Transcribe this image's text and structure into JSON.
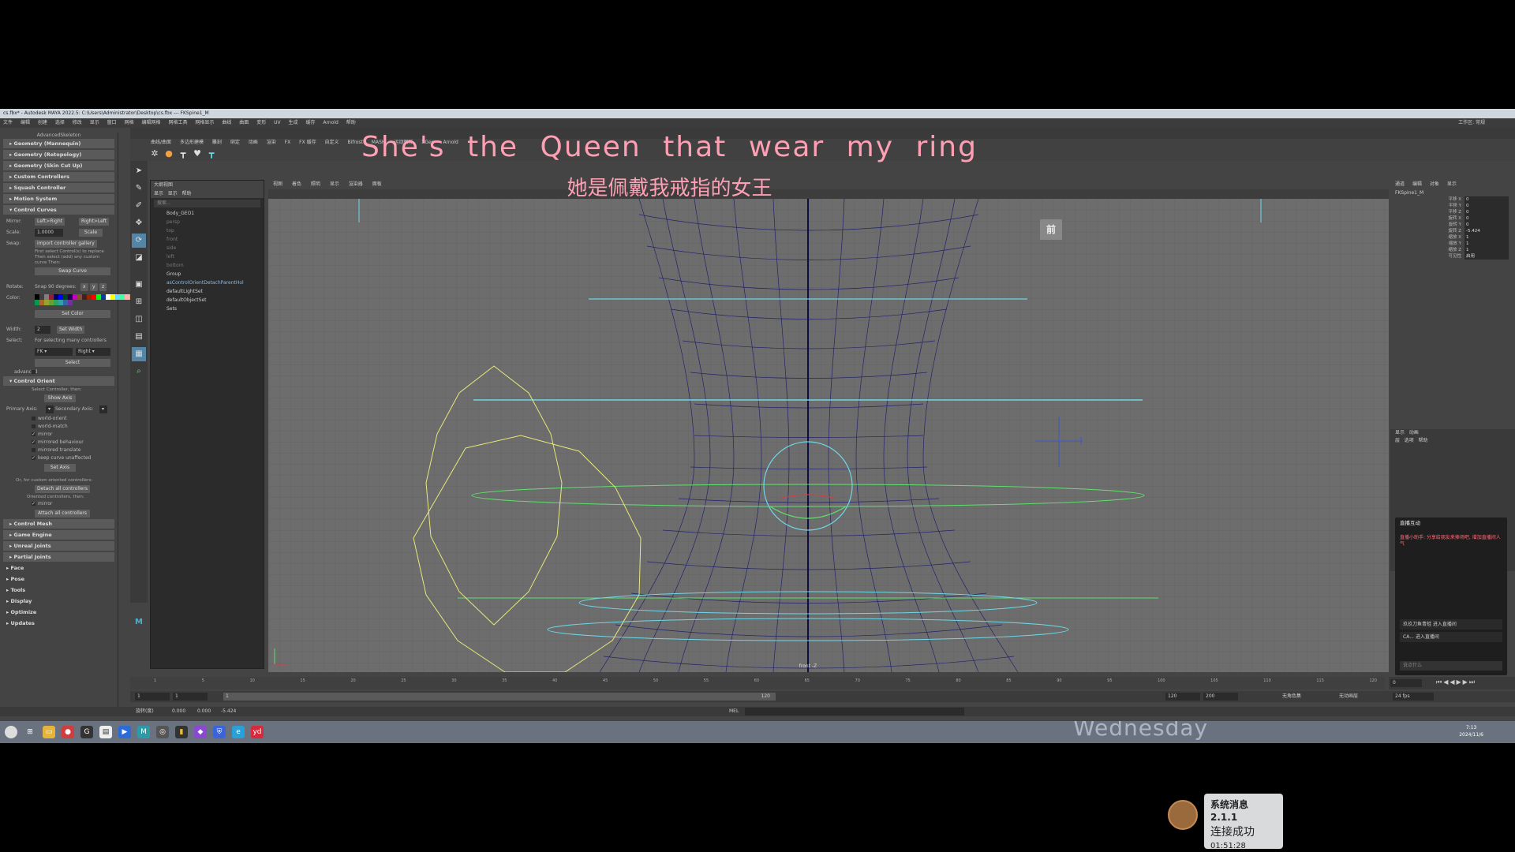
{
  "window": {
    "title": "cs.fbx* - Autodesk MAYA 2022.5: C:\\Users\\Administrator\\Desktop\\cs.fbx  ---  FKSpine1_M",
    "workspace": "工作区: 常规"
  },
  "menus": [
    "文件",
    "编辑",
    "创建",
    "选择",
    "修改",
    "显示",
    "窗口",
    "网格",
    "编辑网格",
    "网格工具",
    "网格显示",
    "曲线",
    "曲面",
    "变形",
    "UV",
    "生成",
    "缓存",
    "Arnold",
    "帮助"
  ],
  "shelf_tabs": [
    "曲线/曲面",
    "多边形建模",
    "雕刻",
    "绑定",
    "动画",
    "渲染",
    "FX",
    "FX 缓存",
    "自定义",
    "Bifrost",
    "MASH",
    "运动图形",
    "XGen",
    "Arnold"
  ],
  "left_panel": {
    "header": "AdvancedSkeleton",
    "sections_top": [
      "Geometry (Mannequin)",
      "Geometry (Retopology)",
      "Geometry (Skin Cut Up)",
      "Custom Controllers",
      "Squash Controller",
      "Motion System"
    ],
    "control_curves": "Control Curves",
    "mirror_label": "Mirror:",
    "mirror_a": "Left>Right",
    "mirror_b": "Right>Left",
    "scale_label": "Scale:",
    "scale_value": "1.0000",
    "scale_btn": "Scale",
    "swap_label": "Swap:",
    "swap_gallery": "import controller gallery",
    "swap_note": "First select Control(s) to replace Then select (add) any custom curve Then:",
    "swap_btn": "Swap Curve",
    "rotate_label": "Rotate:",
    "rotate_value": "Snap 90 degrees:",
    "rx": "x",
    "ry": "y",
    "rz": "z",
    "color_label": "Color:",
    "set_color": "Set Color",
    "colors": [
      "#000000",
      "#3f3f3f",
      "#7f7f7f",
      "#9b1b30",
      "#000060",
      "#0000ff",
      "#004619",
      "#25004f",
      "#c700c7",
      "#894c33",
      "#3e231f",
      "#992600",
      "#ff0000",
      "#00ff00",
      "#004199",
      "#ffffff",
      "#ffff00",
      "#63dcff",
      "#43ffa3",
      "#ffb0b0",
      "#e4ac79",
      "#ffff63",
      "#009954",
      "#a5692f",
      "#9fa12f",
      "#68a12f",
      "#30a15d",
      "#30a1a1",
      "#3067a1",
      "#6f30a1"
    ],
    "width_label": "Width:",
    "width_value": "2",
    "set_width": "Set Width",
    "select_label": "Select:",
    "select_note": "For selecting many controllers",
    "select_a": "FK",
    "select_b": "Right",
    "select_btn": "Select",
    "advanced": "advanced",
    "control_orient": "Control Orient",
    "orient_note": "Select Controller, then:",
    "show_axis": "Show Axis",
    "primary_axis": "Primary Axis:",
    "secondary_axis": "Secondary Axis:",
    "checks": [
      {
        "label": "world-orient",
        "on": false
      },
      {
        "label": "world-match",
        "on": false
      },
      {
        "label": "mirror",
        "on": true
      },
      {
        "label": "mirrored behaviour",
        "on": true
      },
      {
        "label": "mirrored translate",
        "on": false
      },
      {
        "label": "keep curve unaffected",
        "on": true
      }
    ],
    "set_axis": "Set Axis",
    "custom_note": "Or, for custom oriented controllers:",
    "detach_btn": "Detach all controllers",
    "oriented_note": "Oriented controllers, then:",
    "mirror_check": "mirror",
    "attach_btn": "Attach all controllers",
    "sections_bottom": [
      "Control Mesh",
      "Game Engine",
      "Unreal Joints",
      "Partial Joints"
    ],
    "sections_root": [
      "Face",
      "Pose",
      "Tools",
      "Display",
      "Optimize",
      "Updates"
    ]
  },
  "outliner": {
    "title": "大纲视图",
    "menu": [
      "显示",
      "显示",
      "帮助"
    ],
    "search_placeholder": "搜索...",
    "items": [
      {
        "label": "Body_GEO1",
        "style": ""
      },
      {
        "label": "persp",
        "style": "dim"
      },
      {
        "label": "top",
        "style": "dim"
      },
      {
        "label": "front",
        "style": "dim"
      },
      {
        "label": "side",
        "style": "dim"
      },
      {
        "label": "left",
        "style": "dim"
      },
      {
        "label": "bottom",
        "style": "dim"
      },
      {
        "label": "Group",
        "style": ""
      },
      {
        "label": "asControlOrientDetachParentHol",
        "style": "sel"
      },
      {
        "label": "defaultLightSet",
        "style": ""
      },
      {
        "label": "defaultObjectSet",
        "style": ""
      },
      {
        "label": "Sets",
        "style": ""
      }
    ]
  },
  "viewport": {
    "menu": [
      "视图",
      "着色",
      "照明",
      "显示",
      "渲染器",
      "面板"
    ],
    "front_label": "前",
    "cam_label": "front -Z",
    "accent_cyan": "#6fd6e8",
    "accent_yellow": "#e8e87a",
    "accent_green": "#5fe06f",
    "wire_color": "#23236b"
  },
  "attributes": {
    "tabs": [
      "通道",
      "编辑",
      "对象",
      "显示"
    ],
    "node": "FKSpine1_M",
    "rows": [
      {
        "name": "平移 X",
        "value": "0"
      },
      {
        "name": "平移 Y",
        "value": "0"
      },
      {
        "name": "平移 Z",
        "value": "0"
      },
      {
        "name": "旋转 X",
        "value": "0"
      },
      {
        "name": "旋转 Y",
        "value": "0"
      },
      {
        "name": "旋转 Z",
        "value": "-5.424"
      },
      {
        "name": "缩放 X",
        "value": "1"
      },
      {
        "name": "缩放 Y",
        "value": "1"
      },
      {
        "name": "缩放 Z",
        "value": "1"
      },
      {
        "name": "可见性",
        "value": "启用"
      }
    ],
    "layers_tabs": [
      "显示",
      "动画"
    ],
    "layers_menu": [
      "层",
      "选项",
      "帮助"
    ]
  },
  "live_chat": {
    "title": "直播互动",
    "notice": "直播小助手: 分享给朋友来捧场吧, 增加直播间人气",
    "chats": [
      "玖玖刀鱼青蛙 进入直播间",
      "CA... 进入直播间"
    ],
    "input_placeholder": "说点什么"
  },
  "timeline": {
    "ticks": [
      "1",
      "5",
      "10",
      "15",
      "20",
      "25",
      "30",
      "35",
      "40",
      "45",
      "50",
      "55",
      "60",
      "65",
      "70",
      "75",
      "80",
      "85",
      "90",
      "95",
      "100",
      "105",
      "110",
      "115",
      "120"
    ],
    "current_frame": "0",
    "start": "1",
    "start2": "1",
    "range_label": "1",
    "range_end": "120",
    "end": "120",
    "end2": "200",
    "char_set": "无角色集",
    "anim_layer": "无动画层",
    "fps": "24 fps"
  },
  "cmdline": {
    "label": "MEL",
    "fields": [
      "0.000",
      "0.000",
      "-5.424"
    ],
    "prefix": "旋转(度)"
  },
  "taskbar": {
    "wallpaper_text": "Wednesday",
    "time": "7:13",
    "date": "2024/11/6"
  },
  "subtitles": {
    "en": "She's the Queen that wear my ring",
    "zh": "她是佩戴我戒指的女王"
  },
  "toast": {
    "title": "系统消息 2.1.1",
    "body": "连接成功",
    "time": "01:51:28"
  }
}
